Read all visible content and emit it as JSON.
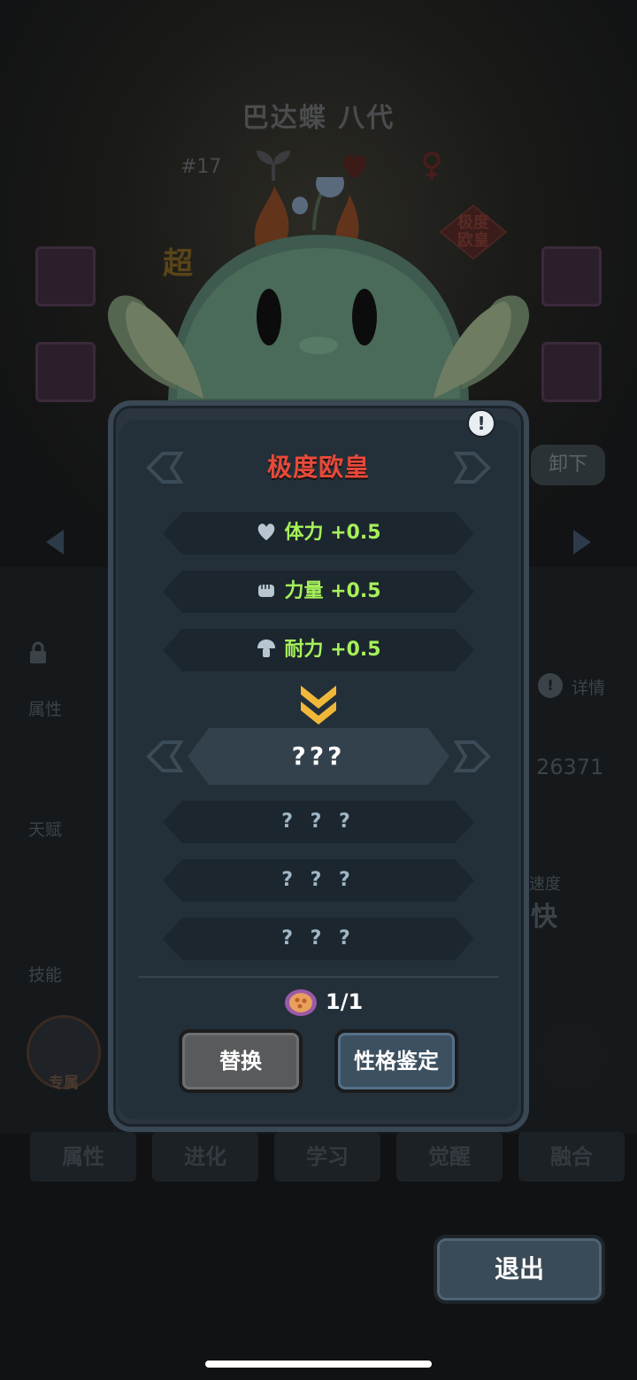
{
  "background": {
    "pet_name": "巴达蝶 八代",
    "pet_number": "#17",
    "badge_extreme": "极度\n欧皇",
    "super_label": "超",
    "unequip_label": "卸下",
    "labels": {
      "attributes": "属性",
      "talent": "天赋",
      "skills": "技能",
      "detail": "详情",
      "speed": "速度",
      "speed_value": "快",
      "exclusive": "专属"
    },
    "stat_number": "26371",
    "bottom_tabs": [
      {
        "label": "属性",
        "icon": "paw-icon"
      },
      {
        "label": "进化",
        "icon": "evolve-icon"
      },
      {
        "label": "学习",
        "icon": "book-icon"
      },
      {
        "label": "觉醒",
        "icon": "awaken-icon"
      },
      {
        "label": "融合",
        "icon": "fusion-icon"
      }
    ],
    "exit_label": "退出"
  },
  "panel": {
    "title": "极度欧皇",
    "current_traits": [
      {
        "icon": "heart-icon",
        "text": "体力 +0.5"
      },
      {
        "icon": "fist-icon",
        "text": "力量 +0.5"
      },
      {
        "icon": "mushroom-icon",
        "text": "耐力 +0.5"
      }
    ],
    "new_title": "???",
    "new_traits": [
      "? ? ?",
      "? ? ?",
      "? ? ?"
    ],
    "token_count": "1/1",
    "replace_label": "替换",
    "appraise_label": "性格鉴定",
    "info_label": "!"
  },
  "colors": {
    "title_red": "#e84a3a",
    "trait_green": "#a6f05a",
    "panel_bg": "#2a3540",
    "chevron_gold": "#f0b83a"
  }
}
